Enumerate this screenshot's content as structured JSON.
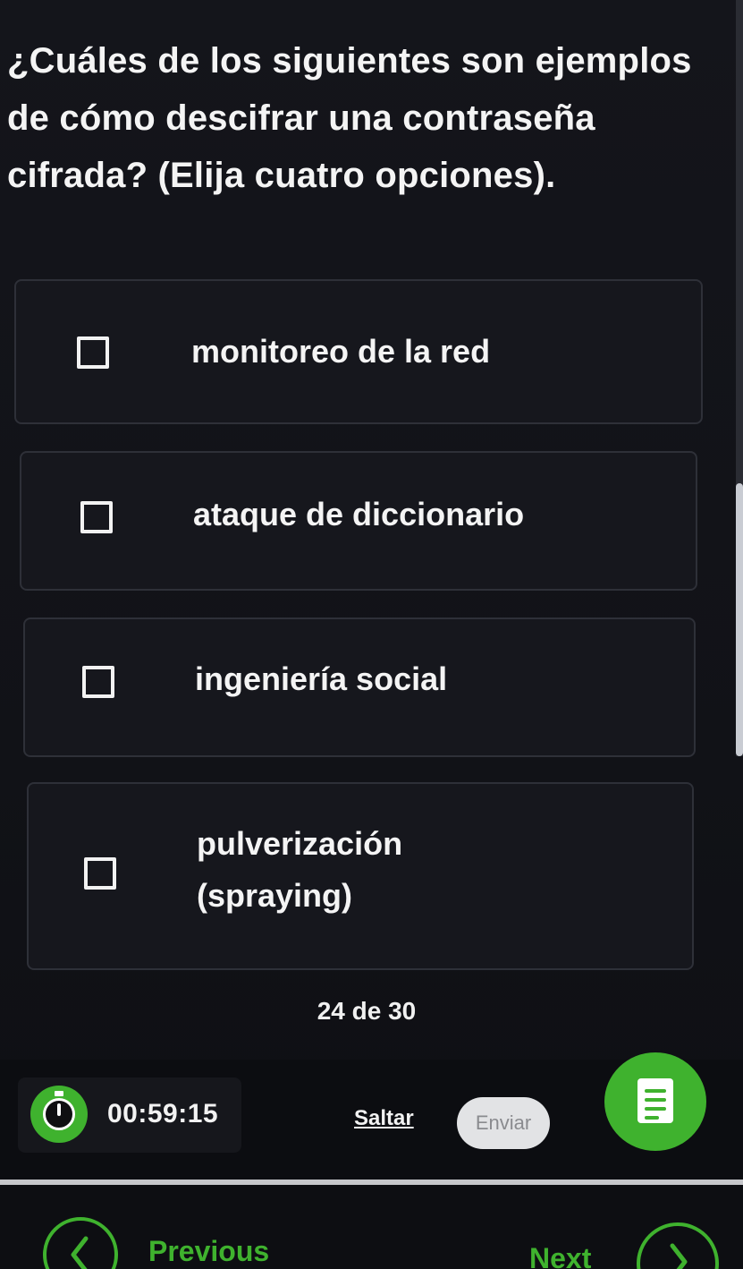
{
  "question": {
    "text": "¿Cuáles de los siguientes son ejemplos de cómo descifrar una contraseña cifrada? (Elija cuatro opciones)."
  },
  "options": [
    {
      "label": "monitoreo de la red",
      "checked": false
    },
    {
      "label": "ataque de diccionario",
      "checked": false
    },
    {
      "label": "ingeniería social",
      "checked": false
    },
    {
      "label": "pulverización (spraying)",
      "checked": false
    }
  ],
  "progress": {
    "text": "24 de 30",
    "current": 24,
    "total": 30
  },
  "footer": {
    "timer": "00:59:15",
    "skip_label": "Saltar",
    "submit_label": "Enviar",
    "question_list_icon": "list-icon"
  },
  "nav": {
    "previous_label": "Previous",
    "next_label": "Next"
  },
  "colors": {
    "background": "#111217",
    "accent": "#3fb22e",
    "text": "#f4f4f4"
  }
}
